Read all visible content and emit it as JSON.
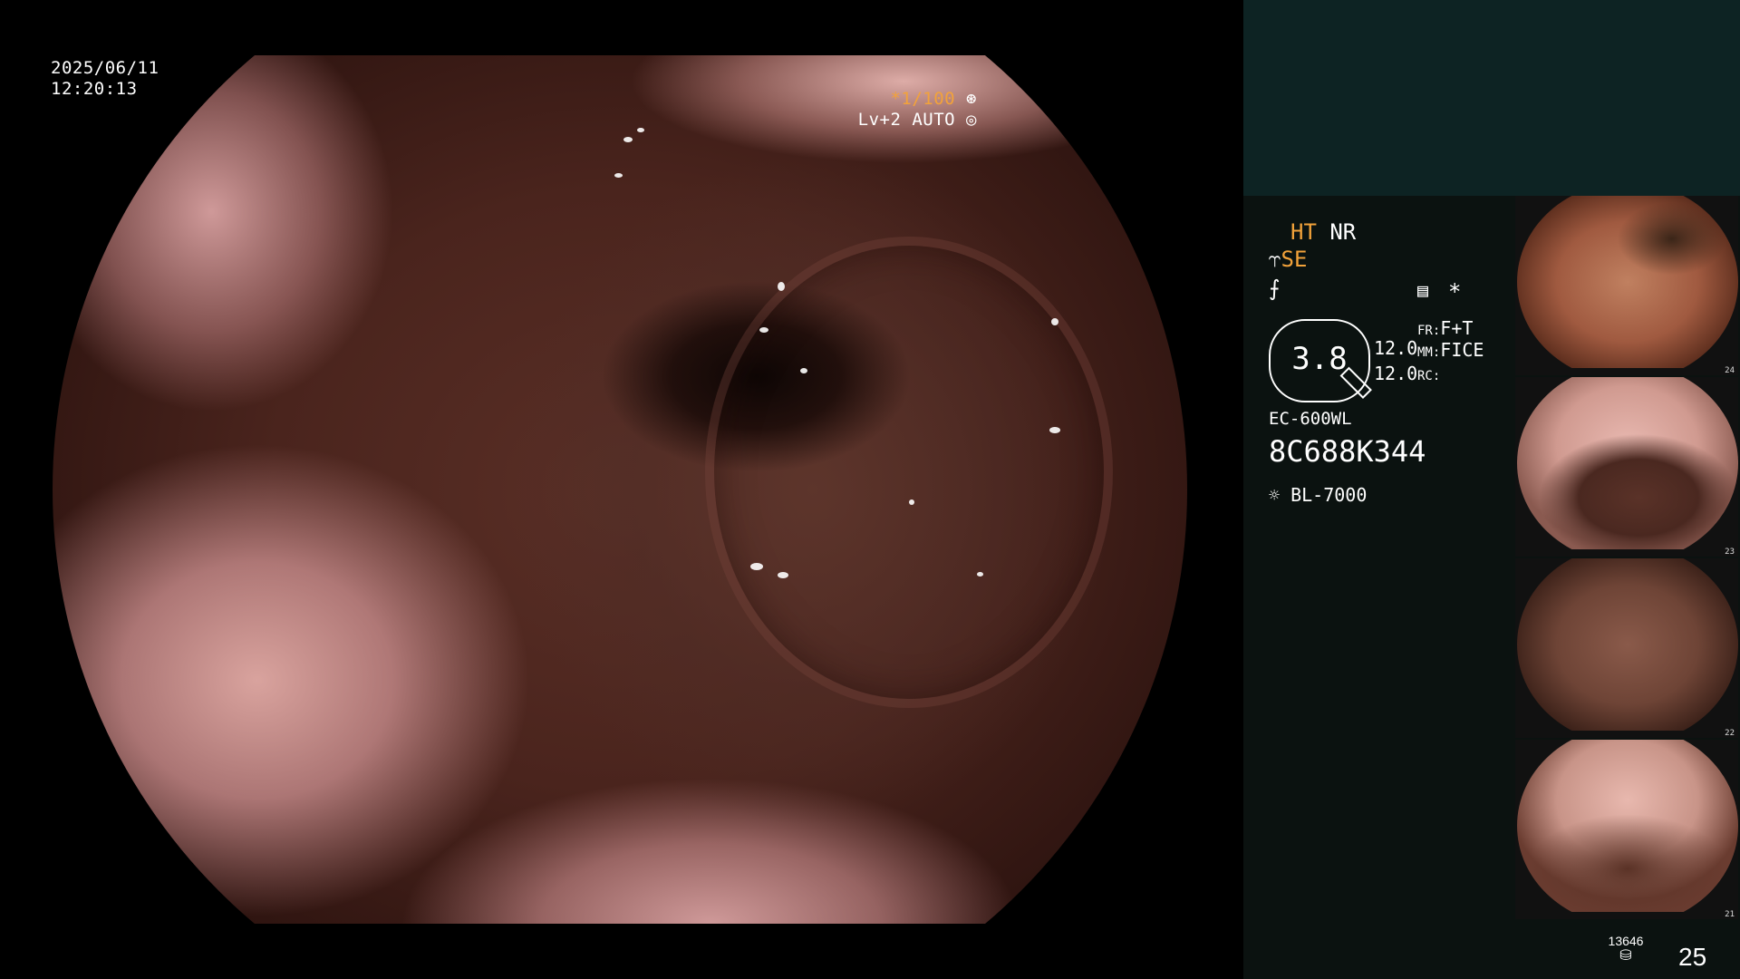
{
  "overlay": {
    "date": "2025/06/11",
    "time": "12:20:13",
    "shutter": "*1/100",
    "level": "Lv+2 AUTO"
  },
  "panel": {
    "ht": "HT",
    "nr": "NR",
    "se": "SE",
    "gauge_value": "3.8",
    "val1": "12.0",
    "val2": "12.0",
    "fr_label": "FR:",
    "fr_value": "F+T",
    "mm_label": "MM:",
    "mm_value": "FICE",
    "rc_label": "RC:",
    "asterisk": "*",
    "scope_model": "EC-600WL",
    "serial": "8C688K344",
    "light_source": "BL-7000"
  },
  "thumbnails": [
    {
      "number": "24"
    },
    {
      "number": "23"
    },
    {
      "number": "22"
    },
    {
      "number": "21"
    }
  ],
  "storage": {
    "count": "13646",
    "image_count": "25"
  },
  "colors": {
    "accent_orange": "#f2a23a",
    "panel_top": "#0d2323",
    "panel_bg": "#0b1210"
  }
}
